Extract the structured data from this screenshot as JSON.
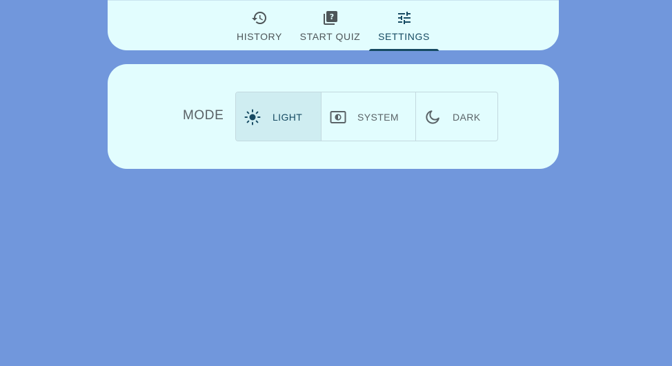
{
  "nav": {
    "tabs": [
      {
        "label": "HISTORY",
        "icon": "history-icon",
        "active": false
      },
      {
        "label": "START QUIZ",
        "icon": "quiz-icon",
        "active": false
      },
      {
        "label": "SETTINGS",
        "icon": "tune-icon",
        "active": true
      }
    ]
  },
  "settings": {
    "mode_label": "MODE",
    "mode_options": [
      {
        "label": "LIGHT",
        "icon": "sun-icon",
        "selected": true
      },
      {
        "label": "SYSTEM",
        "icon": "contrast-icon",
        "selected": false
      },
      {
        "label": "DARK",
        "icon": "moon-icon",
        "selected": false
      }
    ]
  },
  "colors": {
    "background": "#7197dc",
    "card": "#e2fdfe",
    "accent": "#164a62",
    "selected_bg": "#cfedf1"
  }
}
